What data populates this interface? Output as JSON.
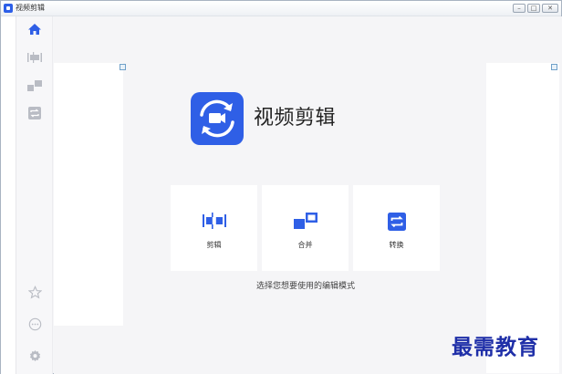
{
  "window": {
    "title": "视频剪辑",
    "controls": {
      "minimize": "–",
      "maximize": "□",
      "close": "✕"
    }
  },
  "sidebar": {
    "items": [
      {
        "name": "home",
        "icon": "home-icon",
        "active": true
      },
      {
        "name": "cut",
        "icon": "cut-icon"
      },
      {
        "name": "merge",
        "icon": "merge-icon"
      },
      {
        "name": "convert",
        "icon": "convert-icon"
      }
    ],
    "bottom_items": [
      {
        "name": "favorite",
        "icon": "star-icon"
      },
      {
        "name": "more",
        "icon": "more-icon"
      },
      {
        "name": "settings",
        "icon": "gear-icon"
      }
    ]
  },
  "main": {
    "app_name": "视频剪辑",
    "modes": [
      {
        "label": "剪辑",
        "icon": "cut-icon"
      },
      {
        "label": "合并",
        "icon": "merge-icon"
      },
      {
        "label": "转换",
        "icon": "convert-icon"
      }
    ],
    "hint": "选择您想要使用的编辑模式"
  },
  "watermark": "最需教育",
  "colors": {
    "accent": "#2f5fe6",
    "sidebar_icon": "#b9bcc4",
    "watermark": "#1f2fa8"
  }
}
